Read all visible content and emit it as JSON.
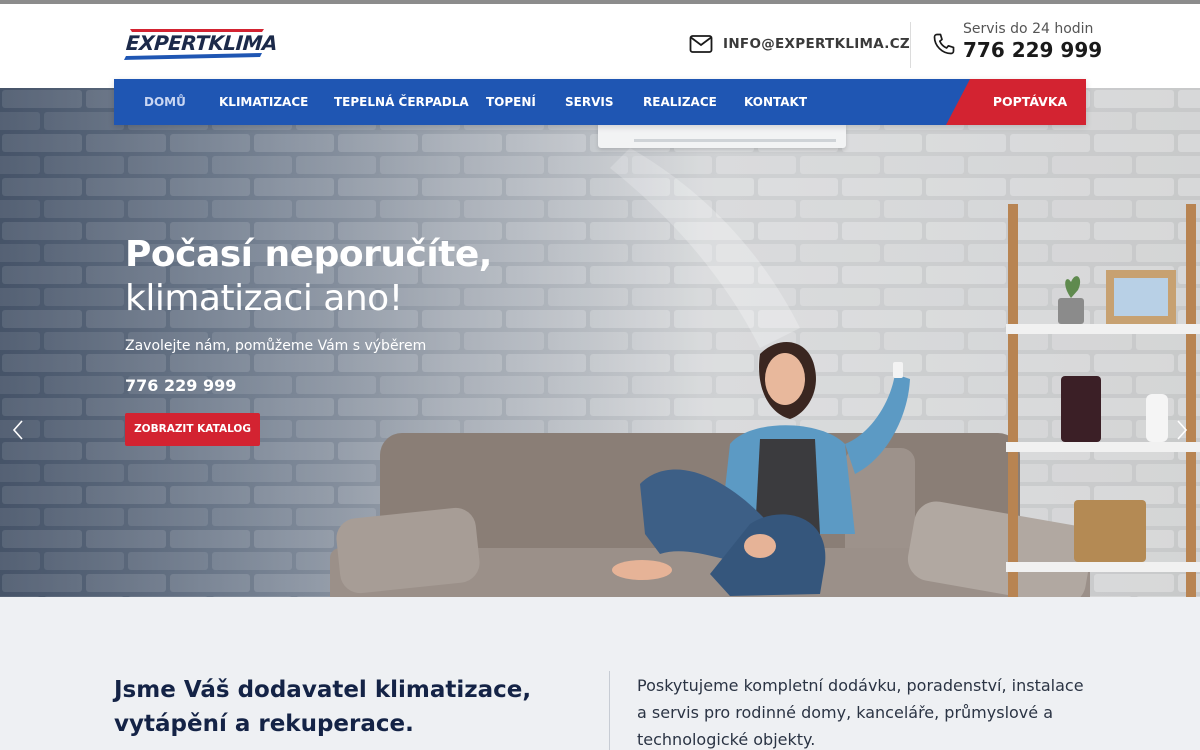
{
  "brand": {
    "logo_text": "EXPERTKLIMA",
    "colors": {
      "primary_blue": "#1f56b3",
      "accent_red": "#d32331",
      "dark_navy": "#142346"
    }
  },
  "header": {
    "email": {
      "icon": "envelope-icon",
      "text": "INFO@EXPERTKLIMA.CZ"
    },
    "phone": {
      "icon": "phone-icon",
      "caption": "Servis do 24 hodin",
      "number": "776 229 999"
    }
  },
  "nav": {
    "items": [
      {
        "label": "DOMŮ",
        "active": true
      },
      {
        "label": "KLIMATIZACE"
      },
      {
        "label": "TEPELNÁ ČERPADLA"
      },
      {
        "label": "TOPENÍ"
      },
      {
        "label": "SERVIS"
      },
      {
        "label": "REALIZACE"
      },
      {
        "label": "KONTAKT"
      }
    ],
    "cta_label": "POPTÁVKA"
  },
  "hero": {
    "title_bold": "Počasí neporučíte,",
    "title_light": "klimatizaci ano!",
    "subtitle": "Zavolejte nám, pomůžeme Vám s výběrem",
    "phone": "776 229 999",
    "button_label": "ZOBRAZIT KATALOG",
    "prev_icon": "chevron-left-icon",
    "next_icon": "chevron-right-icon"
  },
  "about": {
    "title": "Jsme Váš dodavatel klimatizace, vytápění a rekuperace.",
    "text": "Poskytujeme kompletní dodávku, poradenství, instalace a servis pro rodinné domy, kanceláře, průmyslové a technologické objekty."
  }
}
